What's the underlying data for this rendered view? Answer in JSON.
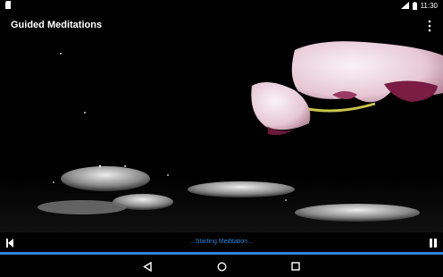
{
  "status_bar": {
    "time": "11:30"
  },
  "app_bar": {
    "title": "Guided Meditations"
  },
  "player": {
    "status": "...Starting Meditation..."
  },
  "colors": {
    "accent": "#2f86d6",
    "background": "#000000"
  },
  "icons": {
    "status_left": "sd-card-icon",
    "signal": "signal-icon",
    "battery": "battery-icon",
    "overflow": "overflow-menu-icon",
    "skip_back": "skip-previous-icon",
    "pause": "pause-icon",
    "back": "nav-back-icon",
    "home": "nav-home-icon",
    "recents": "nav-recents-icon"
  }
}
